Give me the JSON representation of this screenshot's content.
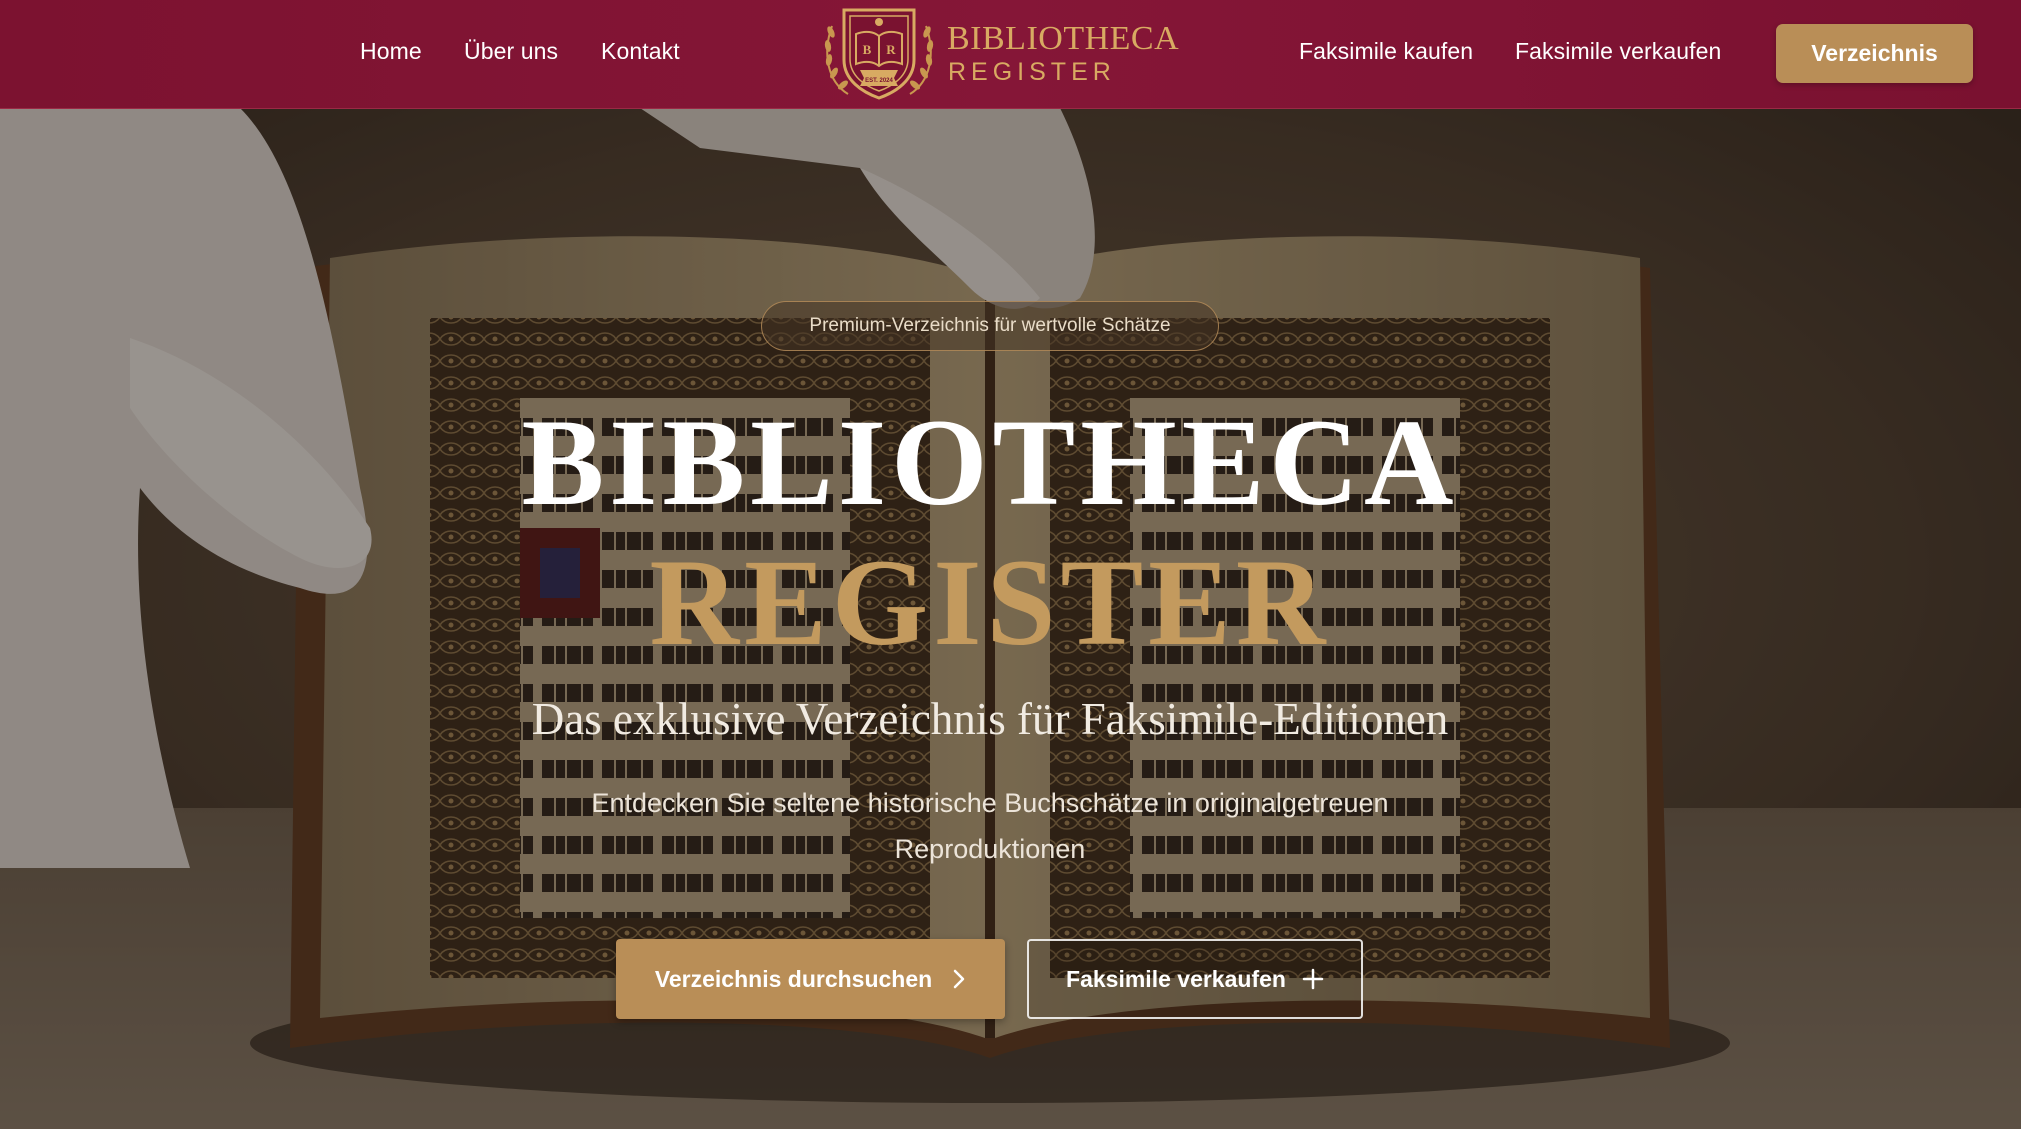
{
  "nav": {
    "links": [
      {
        "label": "Home"
      },
      {
        "label": "Über uns"
      },
      {
        "label": "Kontakt"
      }
    ],
    "right_links": [
      {
        "label": "Faksimile kaufen"
      },
      {
        "label": "Faksimile verkaufen"
      }
    ],
    "cta_label": "Verzeichnis"
  },
  "logo": {
    "line1": "BIBLIOTHECA",
    "line2": "REGISTER",
    "emblem_letters": "B R",
    "emblem_text": "EST. 2024",
    "emblem_icon": "open-book-crest-icon"
  },
  "hero": {
    "badge": "Premium-Verzeichnis für wertvolle Schätze",
    "title_line1": "BIBLIOTHECA",
    "title_line2": "REGISTER",
    "subtitle": "Das exklusive Verzeichnis für Faksimile-Editionen",
    "description": "Entdecken Sie seltene historische Buchschätze in originalgetreuen Reproduktionen",
    "primary_button": "Verzeichnis durchsuchen",
    "primary_icon": "chevron-right-icon",
    "secondary_button": "Faksimile verkaufen",
    "secondary_icon": "plus-icon",
    "background": "open-manuscript-white-gloves-photo"
  },
  "colors": {
    "nav_bg": "#7c1230",
    "gold": "#b98e57",
    "gold_text": "#c39a5e",
    "logo_gold": "#d8aa62",
    "white": "#ffffff"
  }
}
